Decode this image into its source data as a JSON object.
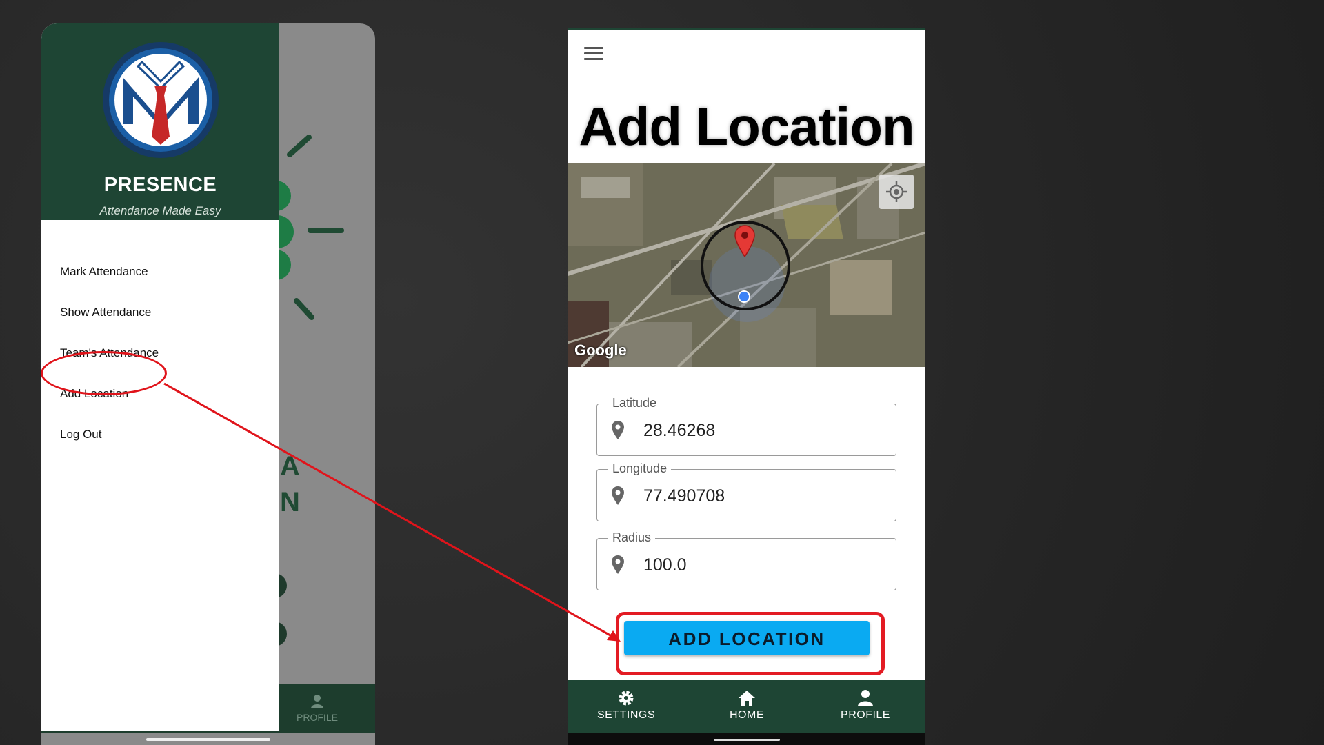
{
  "drawer": {
    "brand_title": "PRESENCE",
    "brand_subtitle": "Attendance Made Easy",
    "menu": [
      {
        "label": "Mark Attendance"
      },
      {
        "label": "Show Attendance"
      },
      {
        "label": "Team's Attendance"
      },
      {
        "label": "Add Location"
      },
      {
        "label": "Log Out"
      }
    ]
  },
  "behind_screen": {
    "profile_label": "PROFILE",
    "deco_letters": [
      "A",
      "N"
    ]
  },
  "add_location": {
    "title": "Add Location",
    "map_attribution": "Google",
    "fields": {
      "latitude": {
        "label": "Latitude",
        "value": "28.46268"
      },
      "longitude": {
        "label": "Longitude",
        "value": "77.490708"
      },
      "radius": {
        "label": "Radius",
        "value": "100.0"
      }
    },
    "button_label": "ADD LOCATION"
  },
  "bottom_nav": {
    "settings": "SETTINGS",
    "home": "HOME",
    "profile": "PROFILE"
  },
  "colors": {
    "brand_green": "#1e4534",
    "button_blue": "#0aaaf2",
    "annotation_red": "#e0141b"
  }
}
